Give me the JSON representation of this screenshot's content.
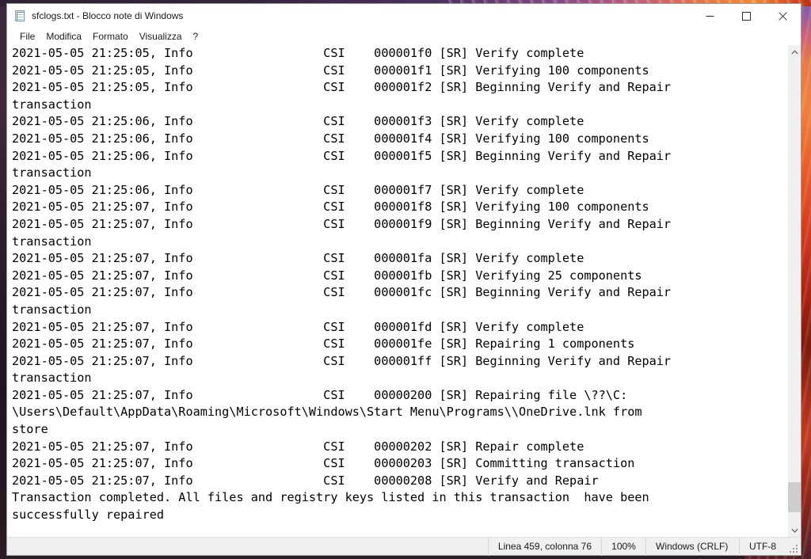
{
  "window": {
    "title": "sfclogs.txt - Blocco note di Windows",
    "icon": "notepad-icon",
    "controls": {
      "minimize_label": "—",
      "maximize_label": "☐",
      "close_label": "✕"
    }
  },
  "menu": {
    "items": [
      {
        "label": "File"
      },
      {
        "label": "Modifica"
      },
      {
        "label": "Formato"
      },
      {
        "label": "Visualizza"
      },
      {
        "label": "?"
      }
    ]
  },
  "editor": {
    "font": "monospace",
    "lines": [
      "2021-05-05 21:25:05, Info                  CSI    000001f0 [SR] Verify complete",
      "2021-05-05 21:25:05, Info                  CSI    000001f1 [SR] Verifying 100 components",
      "2021-05-05 21:25:05, Info                  CSI    000001f2 [SR] Beginning Verify and Repair",
      "transaction",
      "2021-05-05 21:25:06, Info                  CSI    000001f3 [SR] Verify complete",
      "2021-05-05 21:25:06, Info                  CSI    000001f4 [SR] Verifying 100 components",
      "2021-05-05 21:25:06, Info                  CSI    000001f5 [SR] Beginning Verify and Repair",
      "transaction",
      "2021-05-05 21:25:06, Info                  CSI    000001f7 [SR] Verify complete",
      "2021-05-05 21:25:07, Info                  CSI    000001f8 [SR] Verifying 100 components",
      "2021-05-05 21:25:07, Info                  CSI    000001f9 [SR] Beginning Verify and Repair",
      "transaction",
      "2021-05-05 21:25:07, Info                  CSI    000001fa [SR] Verify complete",
      "2021-05-05 21:25:07, Info                  CSI    000001fb [SR] Verifying 25 components",
      "2021-05-05 21:25:07, Info                  CSI    000001fc [SR] Beginning Verify and Repair",
      "transaction",
      "2021-05-05 21:25:07, Info                  CSI    000001fd [SR] Verify complete",
      "2021-05-05 21:25:07, Info                  CSI    000001fe [SR] Repairing 1 components",
      "2021-05-05 21:25:07, Info                  CSI    000001ff [SR] Beginning Verify and Repair",
      "transaction",
      "2021-05-05 21:25:07, Info                  CSI    00000200 [SR] Repairing file \\??\\C:",
      "\\Users\\Default\\AppData\\Roaming\\Microsoft\\Windows\\Start Menu\\Programs\\\\OneDrive.lnk from",
      "store",
      "2021-05-05 21:25:07, Info                  CSI    00000202 [SR] Repair complete",
      "2021-05-05 21:25:07, Info                  CSI    00000203 [SR] Committing transaction",
      "2021-05-05 21:25:07, Info                  CSI    00000208 [SR] Verify and Repair",
      "Transaction completed. All files and registry keys listed in this transaction  have been",
      "successfully repaired"
    ]
  },
  "scrollbar": {
    "up_arrow": "chevron-up",
    "down_arrow": "chevron-down",
    "thumb_position": "near-bottom"
  },
  "status_bar": {
    "cursor_position": "Linea 459, colonna 76",
    "zoom": "100%",
    "line_ending": "Windows (CRLF)",
    "encoding": "UTF-8"
  },
  "colors": {
    "window_bg": "#ffffff",
    "status_bg": "#f0f0f0",
    "text": "#000000",
    "scrollbar_track": "#f0f0f0",
    "scrollbar_thumb": "#cdcdcd",
    "close_hover": "#e81123"
  }
}
